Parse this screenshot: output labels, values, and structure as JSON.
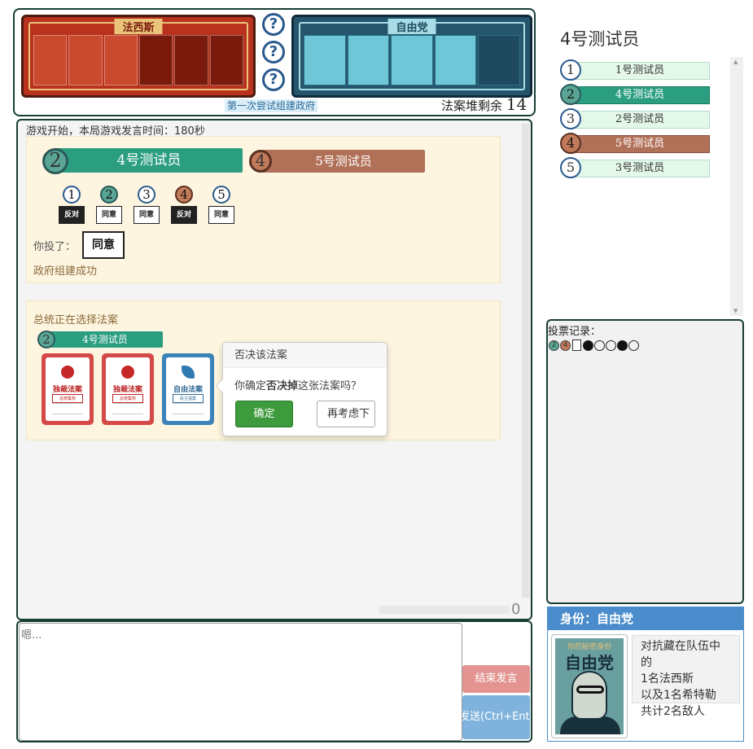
{
  "board": {
    "fascist_title": "法西斯",
    "liberal_title": "自由党",
    "phase": "第一次尝试组建政府",
    "deck_label": "法案堆剩余",
    "deck_count": "14"
  },
  "me": {
    "title": "4号测试员"
  },
  "players": [
    {
      "num": "1",
      "name": "1号测试员",
      "style": "light"
    },
    {
      "num": "2",
      "name": "4号测试员",
      "style": "teal"
    },
    {
      "num": "3",
      "name": "2号测试员",
      "style": "light"
    },
    {
      "num": "4",
      "name": "5号测试员",
      "style": "brown"
    },
    {
      "num": "5",
      "name": "3号测试员",
      "style": "light"
    }
  ],
  "vote_record": {
    "title": "投票记录：",
    "mini": [
      "2",
      "4"
    ]
  },
  "identity": {
    "title": "身份：自由党",
    "card_top": "你的秘密身份",
    "card_party": "自由党",
    "desc": [
      "对抗藏在队伍中的",
      "1名法西斯",
      "以及1名希特勒",
      "共计2名敌人"
    ]
  },
  "chat": {
    "start_msg": "游戏开始，本局游戏发言时间：180秒",
    "scroll_count": "0",
    "president": {
      "num": "2",
      "name": "4号测试员"
    },
    "chancellor": {
      "num": "4",
      "name": "5号测试员"
    },
    "votes": [
      {
        "num": "1",
        "vote": "反对",
        "type": "nein",
        "color": ""
      },
      {
        "num": "2",
        "vote": "同意",
        "type": "ja",
        "color": "teal"
      },
      {
        "num": "3",
        "vote": "同意",
        "type": "ja",
        "color": ""
      },
      {
        "num": "4",
        "vote": "反对",
        "type": "nein",
        "color": "brown"
      },
      {
        "num": "5",
        "vote": "同意",
        "type": "ja",
        "color": ""
      }
    ],
    "you_voted_label": "你投了：",
    "you_voted_value": "同意",
    "gov_success": "政府组建成功",
    "pres_msg": "总统正在选择法案",
    "pres_num": "2",
    "pres_name": "4号测试员",
    "cards": [
      {
        "title": "独裁法案",
        "sub": "总统集权",
        "type": "red"
      },
      {
        "title": "独裁法案",
        "sub": "总统集权",
        "type": "red"
      },
      {
        "title": "自由法案",
        "sub": "民主提案",
        "type": "blue"
      }
    ]
  },
  "popover": {
    "title": "否决该法案",
    "body_pre": "你确定",
    "body_strong": "否决掉",
    "body_post": "这张法案吗？",
    "confirm": "确定",
    "cancel": "再考虑下"
  },
  "input": {
    "placeholder": "嗯...",
    "end_button": "结束发言",
    "send_button": "发送(Ctrl+Enter)"
  },
  "colors": {
    "teal": "#2b9e80",
    "brown": "#b17158",
    "fascist": "#b8321e",
    "liberal": "#24556d",
    "confirm": "#3d9a3d"
  }
}
